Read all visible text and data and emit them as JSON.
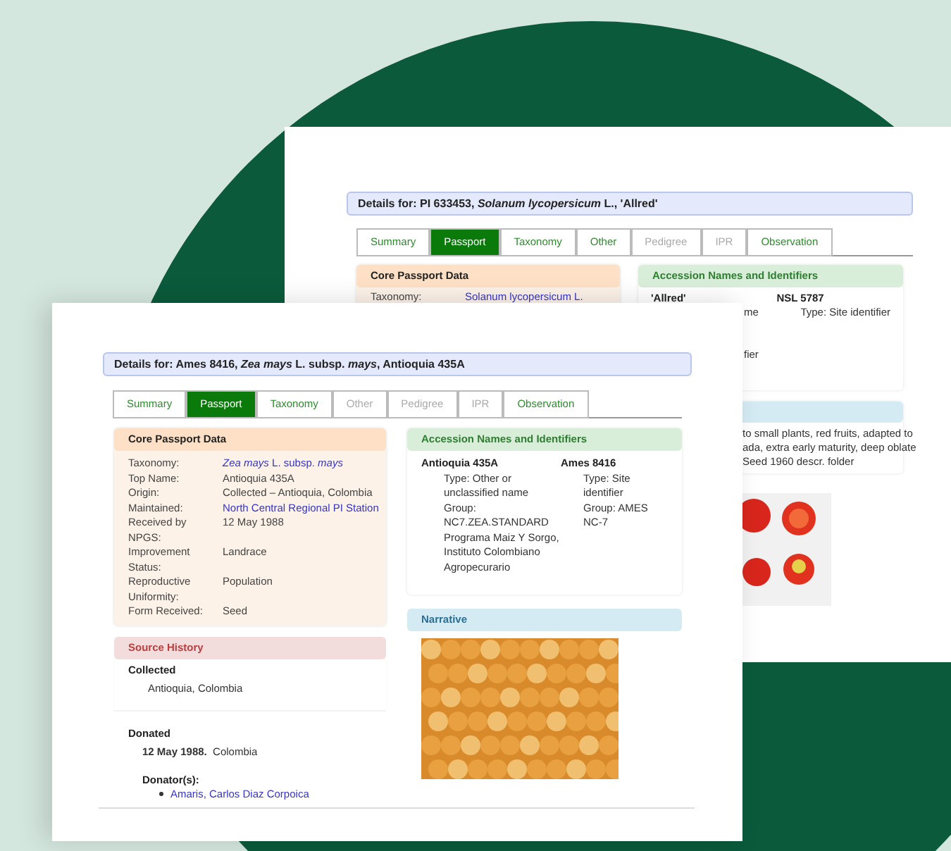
{
  "back_window": {
    "heading": "Details for: PI 633453, *Solanum lycopersicum* L., 'Allred'",
    "tabs": [
      {
        "label": "Summary",
        "selected": false,
        "disabled": false
      },
      {
        "label": "Passport",
        "selected": true,
        "disabled": false
      },
      {
        "label": "Taxonomy",
        "selected": false,
        "disabled": false
      },
      {
        "label": "Other",
        "selected": false,
        "disabled": false
      },
      {
        "label": "Pedigree",
        "selected": false,
        "disabled": true
      },
      {
        "label": "IPR",
        "selected": false,
        "disabled": true
      },
      {
        "label": "Observation",
        "selected": false,
        "disabled": false
      }
    ],
    "core_passport": {
      "title": "Core Passport Data",
      "rows": [
        {
          "label": "Taxonomy:",
          "value": "Solanum lycopersicum L.",
          "kind": "link"
        }
      ]
    },
    "accession_names": {
      "title": "Accession Names and Identifiers",
      "names": [
        {
          "name": "'Allred'",
          "lines": [
            "me",
            "fier"
          ]
        },
        {
          "name": "NSL 5787",
          "lines": [
            "Type: Site identifier"
          ]
        }
      ]
    },
    "narrative": {
      "lines": [
        "to small plants, red fruits, adapted to",
        "ada, extra early maturity, deep oblate",
        "Seed 1960 descr. folder"
      ]
    }
  },
  "front_window": {
    "heading": "Details for: Ames 8416, *Zea mays* L. subsp. *mays*, Antioquia 435A",
    "tabs": [
      {
        "label": "Summary",
        "selected": false,
        "disabled": false
      },
      {
        "label": "Passport",
        "selected": true,
        "disabled": false
      },
      {
        "label": "Taxonomy",
        "selected": false,
        "disabled": false
      },
      {
        "label": "Other",
        "selected": false,
        "disabled": true
      },
      {
        "label": "Pedigree",
        "selected": false,
        "disabled": true
      },
      {
        "label": "IPR",
        "selected": false,
        "disabled": true
      },
      {
        "label": "Observation",
        "selected": false,
        "disabled": false
      }
    ],
    "core_passport": {
      "title": "Core Passport Data",
      "rows": [
        {
          "label": "Taxonomy:",
          "value": "*Zea mays* L. subsp. *mays*",
          "kind": "link"
        },
        {
          "label": "Top Name:",
          "value": "Antioquia 435A",
          "kind": "text"
        },
        {
          "label": "Origin:",
          "value": "Collected – Antioquia, Colombia",
          "kind": "text"
        },
        {
          "label": "Maintained:",
          "value": "North Central Regional PI Station",
          "kind": "link"
        },
        {
          "label": "Received by NPGS:",
          "value": "12 May 1988",
          "kind": "text"
        },
        {
          "label": "Improvement Status:",
          "value": "Landrace",
          "kind": "text"
        },
        {
          "label": "Reproductive Uniformity:",
          "value": "Population",
          "kind": "text"
        },
        {
          "label": "Form Received:",
          "value": "Seed",
          "kind": "text"
        }
      ]
    },
    "accession_names": {
      "title": "Accession Names and Identifiers",
      "names": [
        {
          "name": "Antioquia 435A",
          "lines": [
            "Type: Other or unclassified name",
            "Group: NC7.ZEA.STANDARD",
            "Programa Maiz Y Sorgo, Instituto Colombiano Agropecurario"
          ]
        },
        {
          "name": "Ames 8416",
          "lines": [
            "Type: Site identifier",
            "Group: AMES",
            "NC-7"
          ]
        }
      ]
    },
    "source_history": {
      "title": "Source History",
      "collected": {
        "title": "Collected",
        "place": "Antioquia, Colombia"
      },
      "donated": {
        "title": "Donated",
        "line": "**12 May 1988.**  Colombia",
        "donators_title": "Donator(s):",
        "donators": [
          "Amaris, Carlos Diaz Corpoica"
        ]
      }
    },
    "narrative": {
      "title": "Narrative"
    }
  }
}
